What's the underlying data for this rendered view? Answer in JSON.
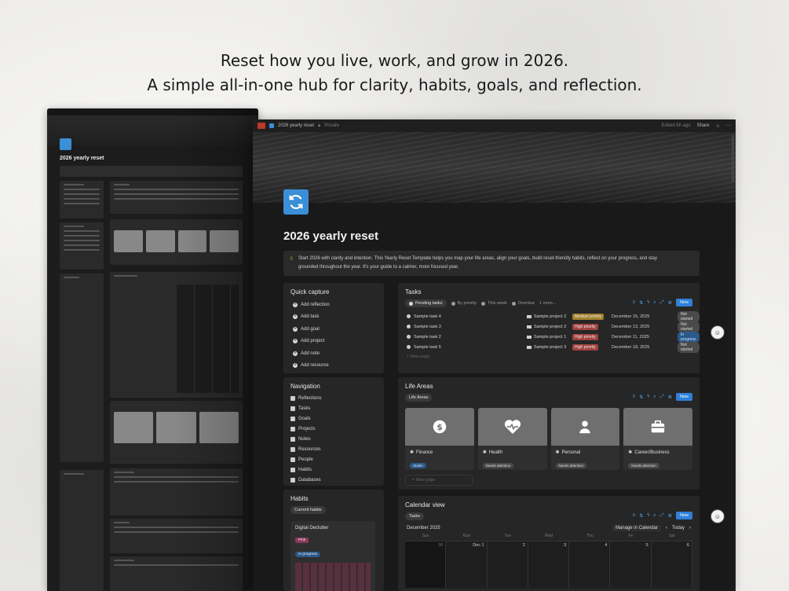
{
  "headline": {
    "line1": "Reset how you live, work, and grow in 2026.",
    "line2": "A simple all-in-one hub for clarity, habits, goals, and reflection."
  },
  "topbar": {
    "page_name": "2026 yearly reset",
    "privacy": "Private",
    "edited": "Edited 6h ago",
    "share": "Share"
  },
  "page": {
    "title": "2026 yearly reset",
    "callout_line1": "Start 2026 with clarity and intention. This Yearly Reset Template helps you map your life areas, align your goals, build reset-friendly habits, reflect on your progress, and stay",
    "callout_line2": "grounded throughout the year. It's your guide to a calmer, more focused year."
  },
  "quick_capture": {
    "title": "Quick capture",
    "items": [
      "Add reflection",
      "Add task",
      "Add goal",
      "Add project",
      "Add note",
      "Add resource"
    ]
  },
  "navigation": {
    "title": "Navigation",
    "items": [
      "Reflections",
      "Tasks",
      "Goals",
      "Projects",
      "Notes",
      "Resources",
      "People",
      "Habits",
      "Databases"
    ]
  },
  "tasks": {
    "title": "Tasks",
    "tabs": [
      "Pending tasks",
      "By priority",
      "This week",
      "Overdue",
      "1 more..."
    ],
    "new_label": "New",
    "new_page": "New page",
    "rows": [
      {
        "name": "Sample task 4",
        "project": "Sample project 2",
        "priority": "Medium priority",
        "prio_color": "#a3822e",
        "date": "December 15, 2025",
        "status": "Not started"
      },
      {
        "name": "Sample task 3",
        "project": "Sample project 2",
        "priority": "High priority",
        "prio_color": "#a0423f",
        "date": "December 13, 2025",
        "status": "Not started"
      },
      {
        "name": "Sample task 2",
        "project": "Sample project 1",
        "priority": "High priority",
        "prio_color": "#a0423f",
        "date": "December 11, 2025",
        "status": "In progress"
      },
      {
        "name": "Sample task 5",
        "project": "Sample project 3",
        "priority": "High priority",
        "prio_color": "#a0423f",
        "date": "December 18, 2025",
        "status": "Not started"
      }
    ]
  },
  "life_areas": {
    "title": "Life Areas",
    "tab": "Life Areas",
    "new_label": "New",
    "new_page": "New page",
    "cards": [
      {
        "name": "Finance",
        "tag": "Stable",
        "icon": "dollar-icon"
      },
      {
        "name": "Health",
        "tag": "Needs attention",
        "icon": "heart-pulse-icon"
      },
      {
        "name": "Personal",
        "tag": "Needs attention",
        "icon": "person-icon"
      },
      {
        "name": "Career/Business",
        "tag": "Needs attention",
        "icon": "briefcase-icon"
      }
    ]
  },
  "habits": {
    "title": "Habits",
    "tab": "Current habits",
    "card_name": "Digital Declutter",
    "pill1": "Pink",
    "pill2": "In progress"
  },
  "calendar": {
    "title": "Calendar view",
    "tab": "Tasks",
    "new_label": "New",
    "month": "December 2025",
    "manage": "Manage in Calendar",
    "today": "Today",
    "weekdays": [
      "Sun",
      "Mon",
      "Tue",
      "Wed",
      "Thu",
      "Fri",
      "Sat"
    ],
    "days": [
      "30",
      "Dec 1",
      "2",
      "3",
      "4",
      "5",
      "6"
    ]
  },
  "mini": {
    "title": "2026 yearly reset"
  }
}
